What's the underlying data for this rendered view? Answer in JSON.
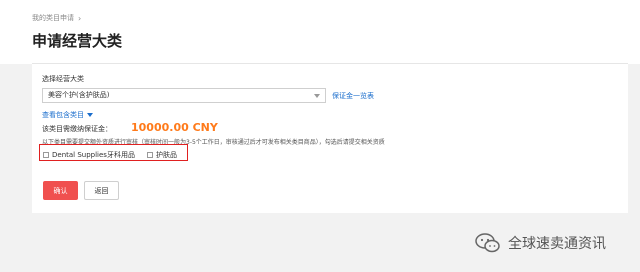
{
  "breadcrumb": {
    "parent": "我的类目申请",
    "chevron": "›"
  },
  "page_title": "申请经营大类",
  "form": {
    "category_label": "选择经营大类",
    "category_value": "美容个护(含护肤品)",
    "deposit_link": "保证金一览表",
    "view_link": "查看包含类目",
    "deposit_label": "该类目需缴纳保证金：",
    "deposit_amount": "10000.00 CNY",
    "notice": "以下类目需要提交额外资质进行审核（审核时间一般为3-5个工作日，审核通过后才可发布相关类目商品），勾选后请提交相关资质",
    "checkboxes": [
      {
        "label": "Dental Supplies牙科用品",
        "checked": false
      },
      {
        "label": "护肤品",
        "checked": false
      }
    ]
  },
  "buttons": {
    "confirm": "确认",
    "back": "返回"
  },
  "watermark": {
    "text": "全球速卖通资讯",
    "icon": "wechat-icon"
  },
  "colors": {
    "accent": "#f0504f",
    "link": "#1a6dcc",
    "amount": "#ff7a1a",
    "highlight": "#e02020"
  }
}
